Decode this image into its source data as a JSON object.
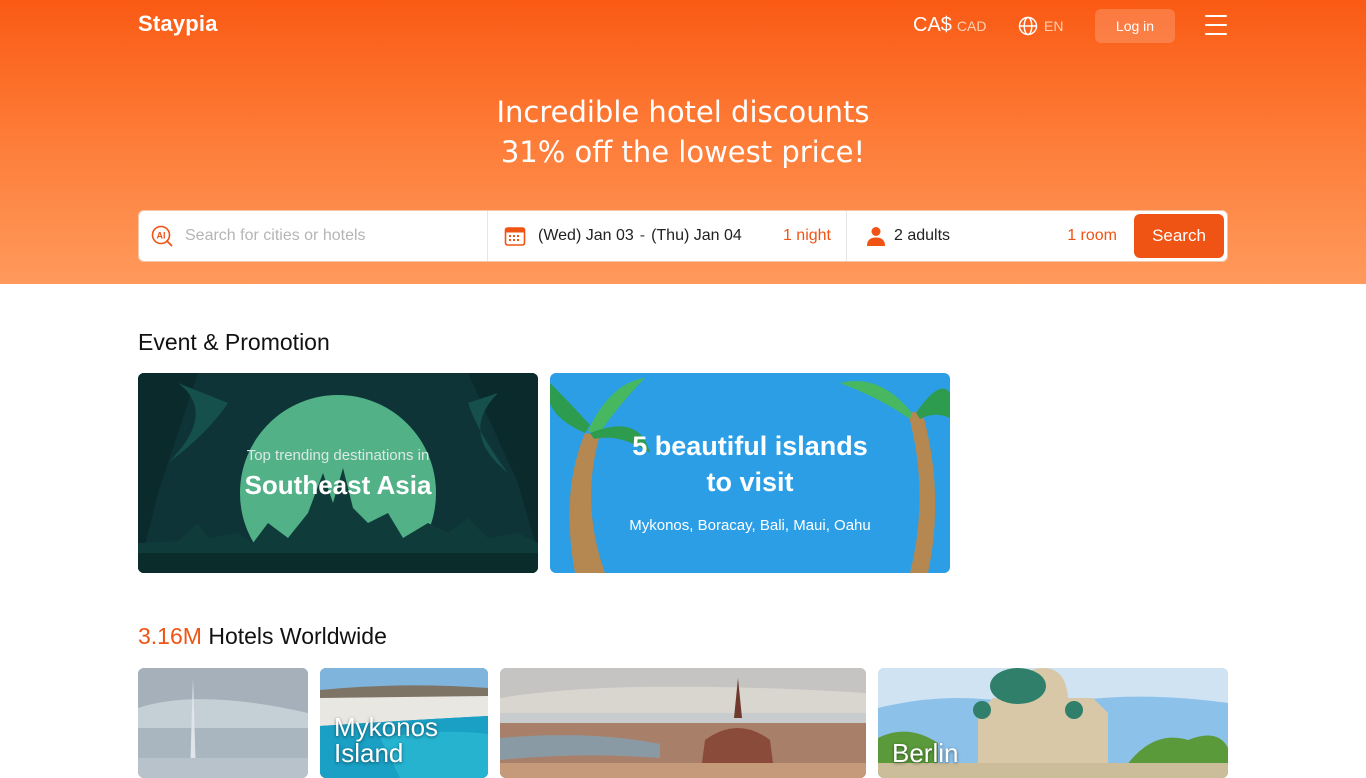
{
  "header": {
    "logo": "Staypia",
    "currency_symbol": "CA$",
    "currency_code": "CAD",
    "language": "EN",
    "login_label": "Log in"
  },
  "hero": {
    "line1": "Incredible hotel discounts",
    "line2": "31% off the lowest price!"
  },
  "search": {
    "placeholder": "Search for cities or hotels",
    "checkin": "(Wed) Jan 03",
    "separator": "-",
    "checkout": "(Thu) Jan 04",
    "nights": "1 night",
    "guests": "2 adults",
    "rooms": "1 room",
    "button_label": "Search"
  },
  "promotions": {
    "title": "Event & Promotion",
    "cards": [
      {
        "subtitle": "Top trending destinations in",
        "title": "Southeast Asia"
      },
      {
        "title_line1": "5 beautiful islands",
        "title_line2": "to visit",
        "subtitle": "Mykonos, Boracay, Bali, Maui, Oahu"
      }
    ]
  },
  "hotels": {
    "count": "3.16M",
    "title_rest": " Hotels Worldwide",
    "destinations": [
      {
        "name": ""
      },
      {
        "name_line1": "Mykonos",
        "name_line2": "Island"
      },
      {
        "name": ""
      },
      {
        "name": "Berlin"
      }
    ]
  },
  "colors": {
    "accent": "#f05414",
    "hero_top": "#fa5a14",
    "hero_bottom": "#ff9a5c"
  }
}
